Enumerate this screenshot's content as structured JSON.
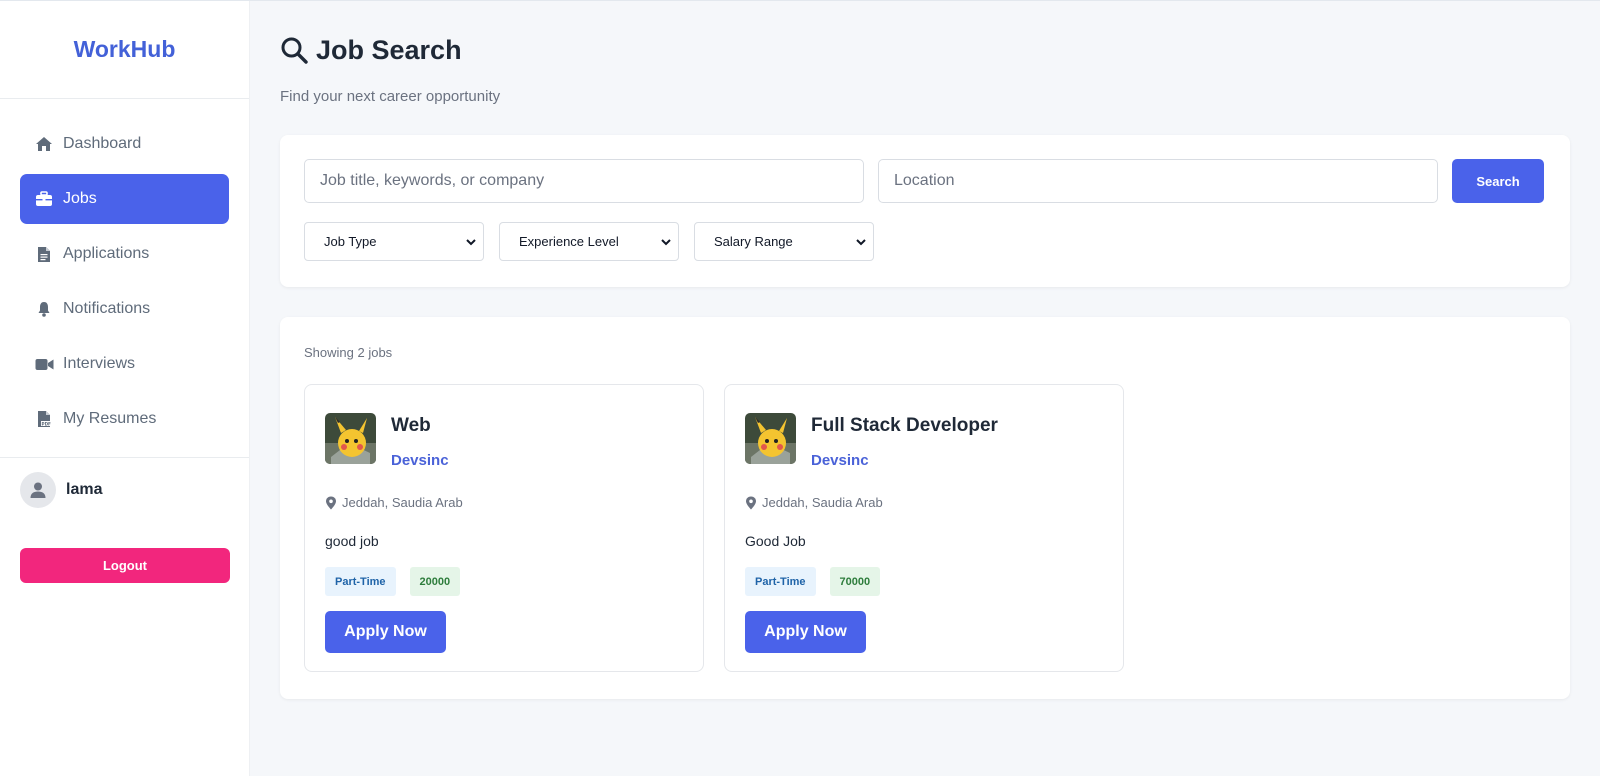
{
  "sidebar": {
    "brand": "WorkHub",
    "items": [
      {
        "label": "Dashboard",
        "icon": "home-icon",
        "active": false
      },
      {
        "label": "Jobs",
        "icon": "briefcase-icon",
        "active": true
      },
      {
        "label": "Applications",
        "icon": "file-icon",
        "active": false
      },
      {
        "label": "Notifications",
        "icon": "bell-icon",
        "active": false
      },
      {
        "label": "Interviews",
        "icon": "video-icon",
        "active": false
      },
      {
        "label": "My Resumes",
        "icon": "pdf-file-icon",
        "active": false
      }
    ],
    "user": {
      "name": "lama",
      "icon": "user-icon"
    },
    "logout_label": "Logout"
  },
  "header": {
    "title": "Job Search",
    "title_icon": "search-icon",
    "subtitle": "Find your next career opportunity"
  },
  "search": {
    "keyword_placeholder": "Job title, keywords, or company",
    "keyword_value": "",
    "location_placeholder": "Location",
    "location_value": "",
    "button_label": "Search",
    "filters": [
      {
        "label": "Job Type"
      },
      {
        "label": "Experience Level"
      },
      {
        "label": "Salary Range"
      }
    ]
  },
  "results": {
    "summary": "Showing 2 jobs",
    "jobs": [
      {
        "title": "Web",
        "company": "Devsinc",
        "location": "Jeddah, Saudia Arab",
        "description": "good job",
        "type": "Part-Time",
        "salary": "20000",
        "apply_label": "Apply Now"
      },
      {
        "title": "Full Stack Developer",
        "company": "Devsinc",
        "location": "Jeddah, Saudia Arab",
        "description": "Good Job",
        "type": "Part-Time",
        "salary": "70000",
        "apply_label": "Apply Now"
      }
    ]
  },
  "colors": {
    "accent": "#4a62ea",
    "brand": "#4361d8",
    "logout": "#f2267d",
    "tag_type_bg": "#e8f3fd",
    "tag_salary_bg": "#e5f5e8"
  }
}
